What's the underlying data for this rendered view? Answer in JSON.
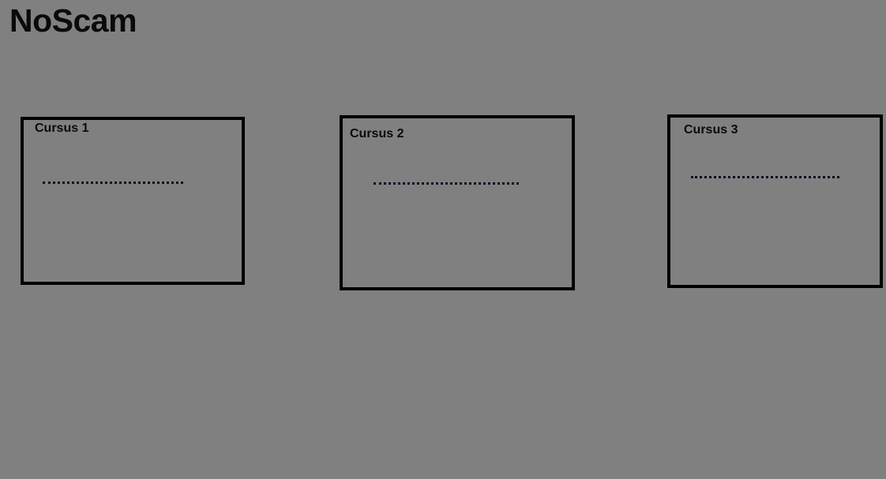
{
  "app": {
    "title": "NoScam"
  },
  "courses": [
    {
      "title": "Cursus 1",
      "placeholder": ""
    },
    {
      "title": "Cursus 2",
      "placeholder": ""
    },
    {
      "title": "Cursus 3",
      "placeholder": ""
    }
  ]
}
